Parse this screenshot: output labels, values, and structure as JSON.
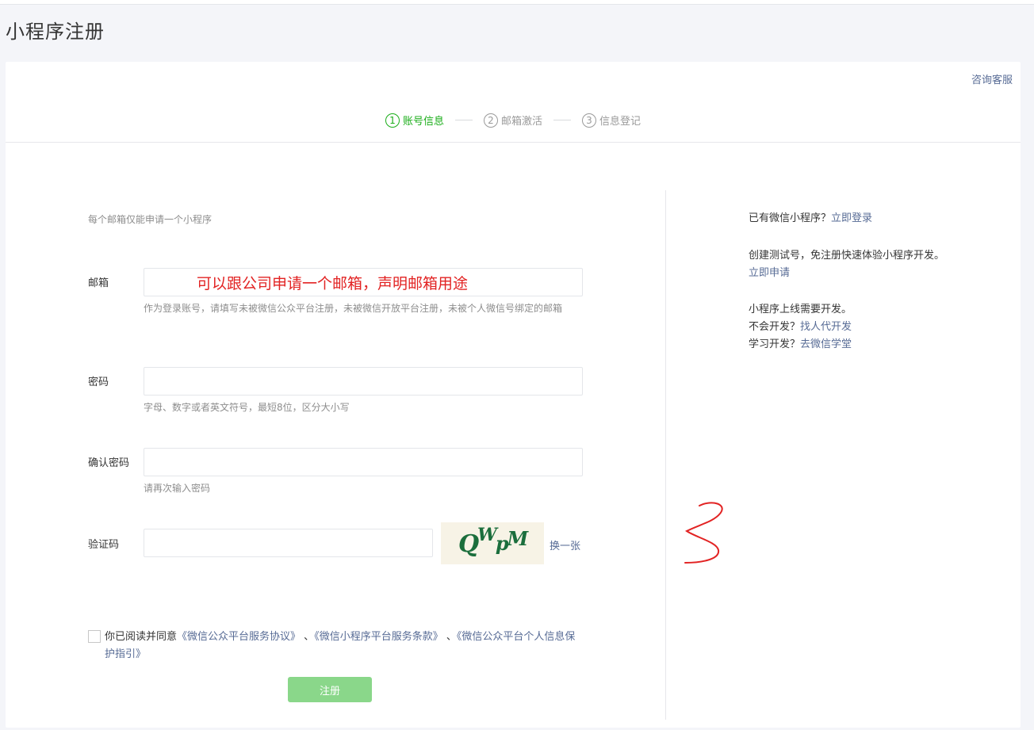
{
  "page": {
    "title": "小程序注册"
  },
  "header": {
    "help_link": "咨询客服"
  },
  "steps": [
    {
      "num": "1",
      "label": "账号信息"
    },
    {
      "num": "2",
      "label": "邮箱激活"
    },
    {
      "num": "3",
      "label": "信息登记"
    }
  ],
  "form": {
    "tip": "每个邮箱仅能申请一个小程序",
    "email": {
      "label": "邮箱",
      "value": "可以跟公司申请一个邮箱，声明邮箱用途",
      "hint": "作为登录账号，请填写未被微信公众平台注册，未被微信开放平台注册，未被个人微信号绑定的邮箱"
    },
    "password": {
      "label": "密码",
      "value": "",
      "hint": "字母、数字或者英文符号，最短8位，区分大小写"
    },
    "confirm_password": {
      "label": "确认密码",
      "value": "",
      "hint": "请再次输入密码"
    },
    "captcha": {
      "label": "验证码",
      "value": "",
      "image_text": "QWpM",
      "refresh_label": "换一张"
    },
    "agreement": {
      "checked": false,
      "prefix": "你已阅读并同意",
      "link1": "《微信公众平台服务协议》",
      "sep1": "、",
      "link2": "《微信小程序平台服务条款》",
      "sep2": "、",
      "link3": "《微信公众平台个人信息保护指引》"
    },
    "submit_label": "注册"
  },
  "sidebar": {
    "login_prefix": "已有微信小程序？",
    "login_link": "立即登录",
    "test_prefix": "创建测试号，免注册快速体验小程序开发。",
    "test_link": "立即申请",
    "dev_text": "小程序上线需要开发。",
    "dev_q1": "不会开发？",
    "dev_link1": "找人代开发",
    "dev_q2": "学习开发？",
    "dev_link2": "去微信学堂"
  },
  "colors": {
    "brand_green": "#1aad19",
    "link": "#576b95",
    "annotation_red": "#e22323"
  }
}
